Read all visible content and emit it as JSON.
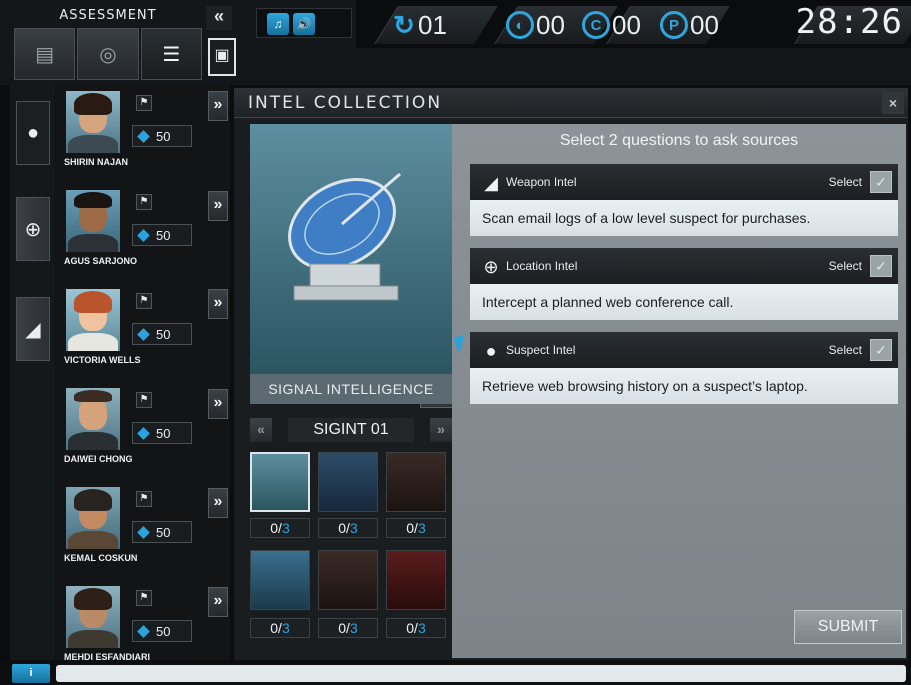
{
  "assessment": {
    "title": "ASSESSMENT",
    "collapse_icon": "double-chevron-left",
    "tabs": [
      "document-icon",
      "eye-icon",
      "checklist-icon"
    ],
    "collapse_label": "«"
  },
  "top": {
    "turn": "01",
    "counter_a": "00",
    "counter_c": "00",
    "counter_p": "00",
    "timer": "28:26",
    "icon_turn": "↻",
    "icon_c": "C",
    "icon_p": "P",
    "music_label": "♫",
    "sound_label": "🔊"
  },
  "characters": [
    {
      "name": "SHIRIN NAJAN",
      "score": "50"
    },
    {
      "name": "AGUS SARJONO",
      "score": "50"
    },
    {
      "name": "VICTORIA WELLS",
      "score": "50"
    },
    {
      "name": "DAIWEI CHONG",
      "score": "50"
    },
    {
      "name": "KEMAL COSKUN",
      "score": "50"
    },
    {
      "name": "MEHDI ESFANDIARI",
      "score": "50"
    }
  ],
  "intel": {
    "title": "INTEL COLLECTION",
    "close": "×",
    "source_type": "SIGNAL INTELLIGENCE",
    "source_id": "SIGINT 01",
    "expand": "^",
    "prev": "«",
    "next": "»",
    "thumb_counts": [
      {
        "done": "0",
        "total": "3"
      },
      {
        "done": "0",
        "total": "3"
      },
      {
        "done": "0",
        "total": "3"
      },
      {
        "done": "0",
        "total": "3"
      },
      {
        "done": "0",
        "total": "3"
      },
      {
        "done": "0",
        "total": "3"
      }
    ],
    "instructions": "Select 2 questions to ask sources",
    "questions": [
      {
        "category": "Weapon Intel",
        "select": "Select",
        "text": "Scan email logs of a low level suspect for purchases."
      },
      {
        "category": "Location Intel",
        "select": "Select",
        "text": "Intercept a planned web conference call."
      },
      {
        "category": "Suspect Intel",
        "select": "Select",
        "text": "Retrieve web browsing history on a suspect’s laptop."
      }
    ],
    "submit": "SUBMIT"
  },
  "bottom": {
    "info": "i"
  },
  "colors": {
    "accent": "#2aa3dc",
    "panel": "#1a1d20",
    "question_bg": "#e9f0f4"
  }
}
